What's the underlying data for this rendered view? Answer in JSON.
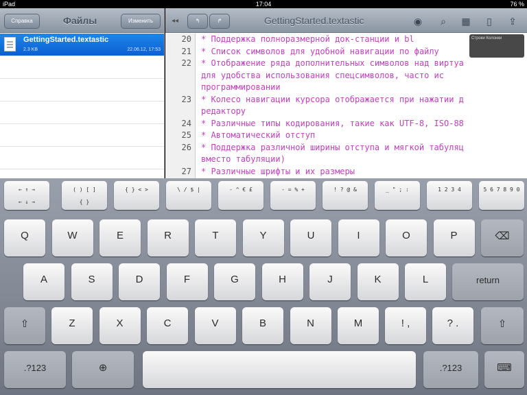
{
  "status": {
    "carrier": "iPad",
    "time": "17:04",
    "battery": "76 %"
  },
  "sidebar": {
    "title": "Файлы",
    "left_button": "Справка",
    "right_button": "Изменить",
    "files": [
      {
        "name": "GettingStarted.textastic",
        "size": "2.3 KB",
        "date": "22.06.12, 17:53"
      }
    ]
  },
  "editor": {
    "title": "GettingStarted.textastic",
    "nav": [
      "↰",
      "↱"
    ],
    "icons": [
      "eye-icon",
      "search-icon",
      "symbols-icon",
      "document-icon",
      "share-icon"
    ],
    "tooltip": "Строки\nКолонки",
    "lines": [
      {
        "num": "20",
        "text": "* Поддержка полноразмерной док-станции и bl"
      },
      {
        "num": "21",
        "text": "* Список символов для удобной навигации по файлу"
      },
      {
        "num": "22",
        "text": "* Отображение ряда дополнительных символов над виртуа"
      },
      {
        "num": "",
        "text": "  для удобства использования спецсимволов, часто ис"
      },
      {
        "num": "",
        "text": "  программировании"
      },
      {
        "num": "23",
        "text": "* Колесо навигации курсора отображается при нажатии д"
      },
      {
        "num": "",
        "text": "  редактору"
      },
      {
        "num": "24",
        "text": "* Различные типы кодирования, такие как UTF-8, ISO-88"
      },
      {
        "num": "25",
        "text": "* Автоматический отступ"
      },
      {
        "num": "26",
        "text": "* Поддержка различной ширины отступа и мягкой табуляц"
      },
      {
        "num": "",
        "text": "  вместо табуляции)"
      },
      {
        "num": "27",
        "text": "* Различные шрифты и их размеры"
      }
    ]
  },
  "keyboard": {
    "ext": [
      [
        "← ↑ →",
        "← ↓ →"
      ],
      [
        "( ) [ ]",
        "{ }"
      ],
      [
        "{ } < >",
        ""
      ],
      [
        "\\ / $ |",
        ""
      ],
      [
        "- ^ € £",
        ""
      ],
      [
        "- = % +",
        ""
      ],
      [
        "! ? @ &",
        ""
      ],
      [
        "_ \" ; :",
        ""
      ],
      [
        "1 2 3 4",
        ""
      ],
      [
        "5 6 7 8 9 0",
        ""
      ]
    ],
    "row1": [
      "Q",
      "W",
      "E",
      "R",
      "T",
      "Y",
      "U",
      "I",
      "O",
      "P"
    ],
    "row2": [
      "A",
      "S",
      "D",
      "F",
      "G",
      "H",
      "J",
      "K",
      "L"
    ],
    "row3": [
      "Z",
      "X",
      "C",
      "V",
      "B",
      "N",
      "M",
      "!",
      ",",
      "?",
      "."
    ],
    "return": "return",
    "num": ".?123"
  }
}
